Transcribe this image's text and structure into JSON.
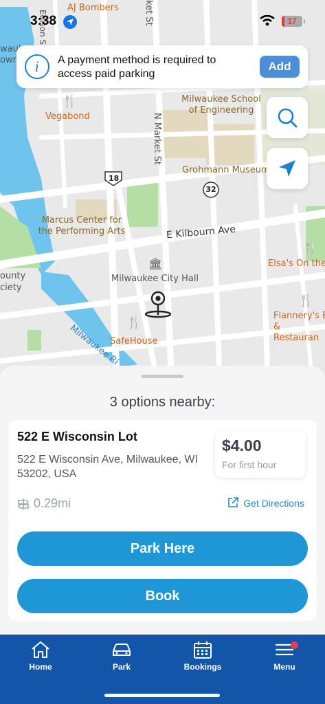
{
  "status_bar": {
    "time": "3:38",
    "battery": "17"
  },
  "banner": {
    "message": "A payment method is required to access paid parking",
    "add_label": "Add"
  },
  "map": {
    "labels": {
      "aj_bombers": "AJ Bombers",
      "edison_st": "Edison St",
      "market_st_top": "ket St",
      "vegabond": "Vegabond",
      "msoe": "Milwaukee School of Engineering",
      "n_market_st": "N Market St",
      "grohmann": "Grohmann Museum",
      "route_18": "18",
      "route_32": "32",
      "marcus": "Marcus Center for the Performing Arts",
      "kilbourn": "E Kilbourn Ave",
      "elsas": "Elsa's On the",
      "county": "ounty",
      "society": "ciety",
      "city_hall": "Milwaukee City Hall",
      "flannerys": "Flannery's B & Restauran",
      "milwaukee_river": "Milwaukee Ri",
      "safehouse": "SafeHouse",
      "town": "own",
      "milwaukee_w": "wauk"
    }
  },
  "sheet": {
    "options_title": "3 options nearby:",
    "lot": {
      "name": "522 E Wisconsin Lot",
      "address": "522 E Wisconsin Ave, Milwaukee, WI 53202, USA",
      "price": "$4.00",
      "price_note": "For first hour",
      "distance": "0.29mi",
      "directions_label": "Get Directions"
    },
    "park_here_label": "Park Here",
    "book_label": "Book"
  },
  "tabs": [
    {
      "label": "Home",
      "icon": "home-icon"
    },
    {
      "label": "Park",
      "icon": "car-icon"
    },
    {
      "label": "Bookings",
      "icon": "calendar-icon"
    },
    {
      "label": "Menu",
      "icon": "menu-icon"
    }
  ],
  "colors": {
    "accent": "#1f97d6",
    "tabbar": "#1156a8",
    "add_button": "#4a90d9",
    "water": "#6ec4ec",
    "park": "#b5dea4"
  }
}
